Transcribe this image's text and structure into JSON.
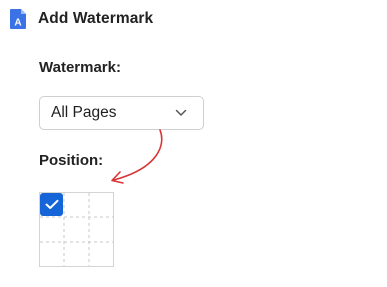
{
  "header": {
    "title": "Add Watermark",
    "app_icon_letter": "A",
    "app_icon": "document-a-icon"
  },
  "watermark": {
    "label": "Watermark:",
    "selected": "All Pages",
    "chevron_icon": "chevron-down-icon"
  },
  "position": {
    "label": "Position:",
    "selected_cell": "top-left",
    "check_icon": "checkmark-icon"
  },
  "colors": {
    "accent": "#1565d8",
    "annotation_arrow": "#d93535"
  }
}
